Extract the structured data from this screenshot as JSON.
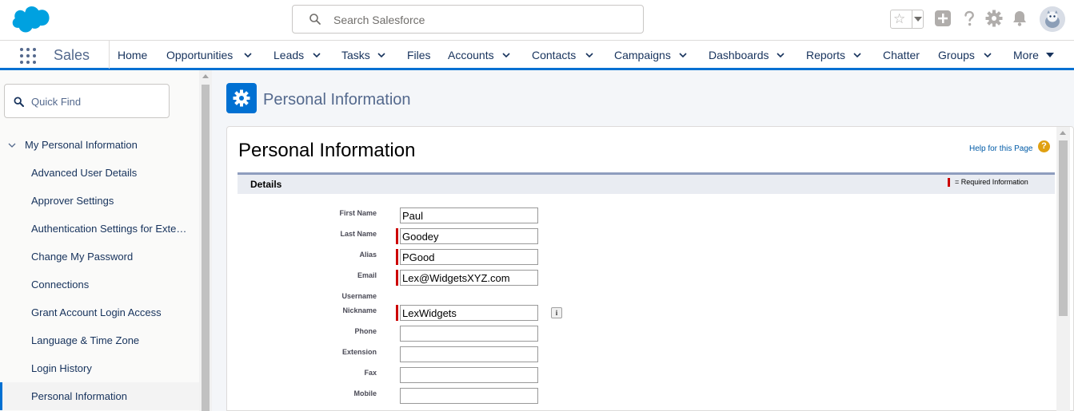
{
  "header": {
    "search_placeholder": "Search Salesforce",
    "icons": [
      "favorites-star-icon",
      "add-icon",
      "help-icon",
      "setup-gear-icon",
      "notifications-bell-icon",
      "avatar"
    ]
  },
  "nav": {
    "app_name": "Sales",
    "items": [
      {
        "label": "Home",
        "dropdown": false
      },
      {
        "label": "Opportunities",
        "dropdown": true
      },
      {
        "label": "Leads",
        "dropdown": true
      },
      {
        "label": "Tasks",
        "dropdown": true
      },
      {
        "label": "Files",
        "dropdown": false
      },
      {
        "label": "Accounts",
        "dropdown": true
      },
      {
        "label": "Contacts",
        "dropdown": true
      },
      {
        "label": "Campaigns",
        "dropdown": true
      },
      {
        "label": "Dashboards",
        "dropdown": true
      },
      {
        "label": "Reports",
        "dropdown": true
      },
      {
        "label": "Chatter",
        "dropdown": false
      },
      {
        "label": "Groups",
        "dropdown": true
      },
      {
        "label": "More",
        "dropdown": true
      }
    ]
  },
  "sidebar": {
    "quick_find_placeholder": "Quick Find",
    "section_label": "My Personal Information",
    "items": [
      {
        "label": "Advanced User Details"
      },
      {
        "label": "Approver Settings"
      },
      {
        "label": "Authentication Settings for External Systems"
      },
      {
        "label": "Change My Password"
      },
      {
        "label": "Connections"
      },
      {
        "label": "Grant Account Login Access"
      },
      {
        "label": "Language & Time Zone"
      },
      {
        "label": "Login History"
      },
      {
        "label": "Personal Information",
        "selected": true
      }
    ]
  },
  "page": {
    "header_title": "Personal Information",
    "card_title": "Personal Information",
    "help_link": "Help for this Page",
    "help_icon_glyph": "?",
    "section_title": "Details",
    "required_legend": "= Required Information",
    "info_glyph": "i",
    "colors": {
      "brand": "#0070d2",
      "required": "#cc0000",
      "section_border": "#8e9dbe"
    }
  },
  "form": {
    "fields": [
      {
        "label": "First Name",
        "value": "Paul",
        "required": false,
        "input": true
      },
      {
        "label": "Last Name",
        "value": "Goodey",
        "required": true,
        "input": true
      },
      {
        "label": "Alias",
        "value": "PGood",
        "required": true,
        "input": true
      },
      {
        "label": "Email",
        "value": "Lex@WidgetsXYZ.com",
        "required": true,
        "input": true
      },
      {
        "label": "Username",
        "value": "",
        "required": false,
        "input": false
      },
      {
        "label": "Nickname",
        "value": "LexWidgets",
        "required": true,
        "input": true,
        "info": true
      },
      {
        "label": "Phone",
        "value": "",
        "required": false,
        "input": true
      },
      {
        "label": "Extension",
        "value": "",
        "required": false,
        "input": true
      },
      {
        "label": "Fax",
        "value": "",
        "required": false,
        "input": true
      },
      {
        "label": "Mobile",
        "value": "",
        "required": false,
        "input": true
      }
    ]
  }
}
